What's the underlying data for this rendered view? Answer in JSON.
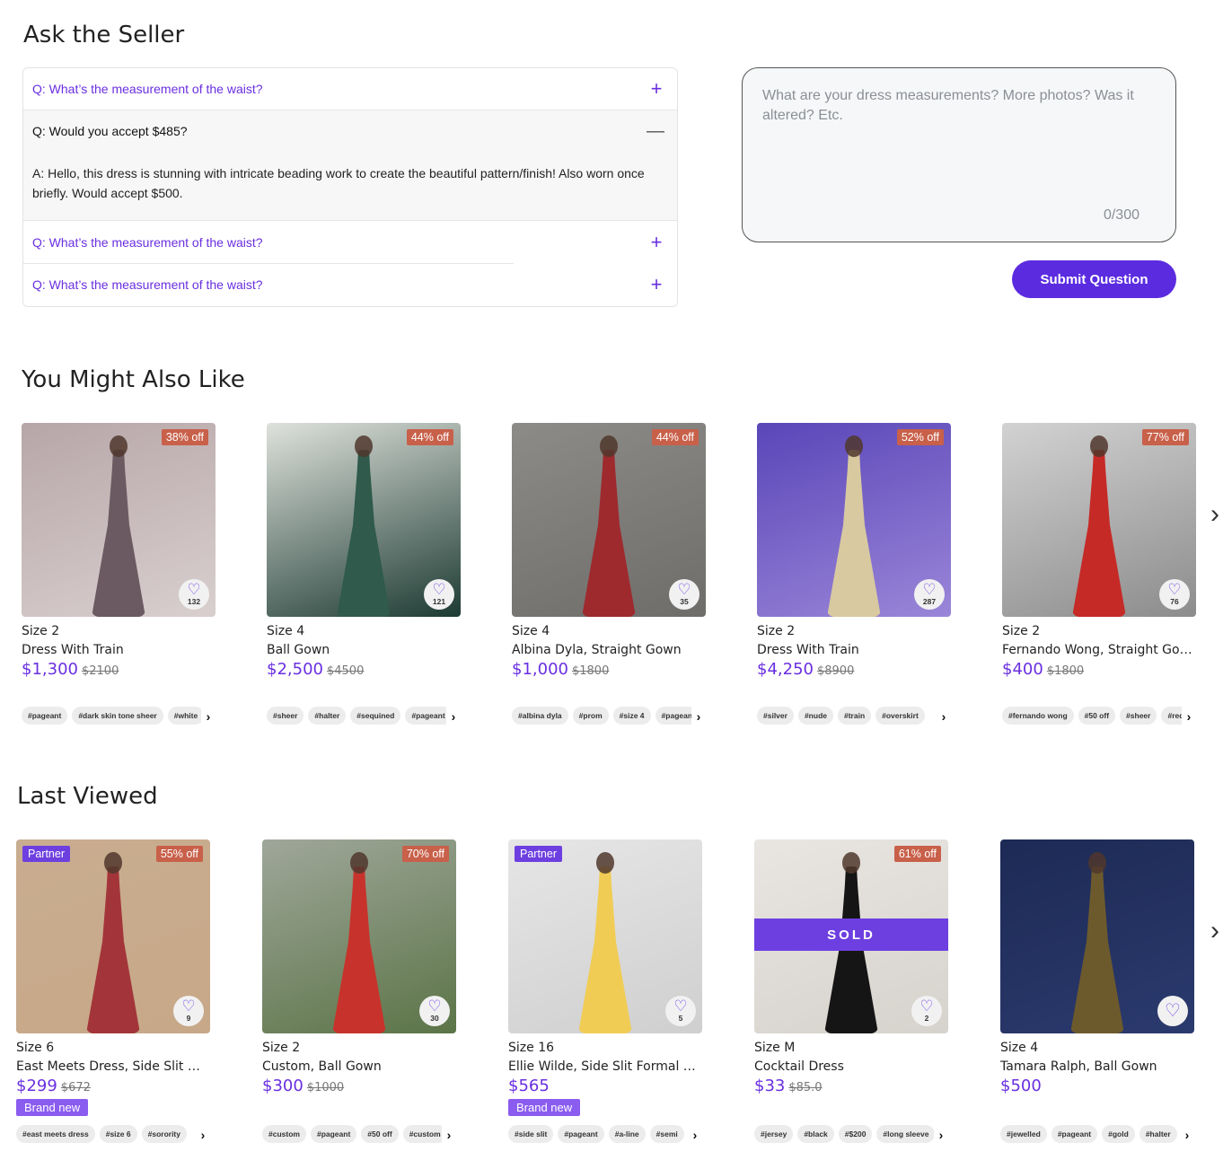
{
  "ask": {
    "title": "Ask the Seller",
    "qa": [
      {
        "q": "Q: What’s the measurement of the waist?",
        "open": false
      },
      {
        "q": "Q: Would you accept $485?",
        "open": true,
        "a": "A: Hello, this dress is stunning with intricate beading work to create the beautiful pattern/finish! Also worn once briefly. Would accept $500."
      },
      {
        "q": "Q: What’s the measurement of the waist?",
        "open": false
      },
      {
        "q": "Q: What’s the measurement of the waist?",
        "open": false
      }
    ],
    "placeholder": "What are your dress measurements? More photos? Was it altered? Etc.",
    "counter": "0/300",
    "submit_label": "Submit Question"
  },
  "icons": {
    "plus": "plus-icon",
    "minus": "minus-icon",
    "heart": "heart-icon",
    "chevron": "chevron-right-icon"
  },
  "colors": {
    "accent": "#6a2fe0",
    "button": "#5b2be0",
    "discount_badge": "#c8604a",
    "partner_badge": "#6d3fe0"
  },
  "might_like": {
    "title": "You Might Also Like",
    "cards": [
      {
        "off": "38% off",
        "likes": "132",
        "size": "Size 2",
        "name": "Dress With Train",
        "price": "$1,300",
        "old": "$2100",
        "tags": [
          "#pageant",
          "#dark skin tone sheer",
          "#white"
        ],
        "img": [
          "#b7a6a8",
          "#6b5a62",
          "#d9cfcf"
        ]
      },
      {
        "off": "44% off",
        "likes": "121",
        "size": "Size 4",
        "name": "Ball Gown",
        "price": "$2,500",
        "old": "$4500",
        "tags": [
          "#sheer",
          "#halter",
          "#sequined",
          "#pageant"
        ],
        "img": [
          "#dfe2dc",
          "#2f5a4c",
          "#1d3b33"
        ]
      },
      {
        "off": "44% off",
        "likes": "35",
        "size": "Size 4",
        "name": "Albina Dyla, Straight Gown",
        "price": "$1,000",
        "old": "$1800",
        "tags": [
          "#albina dyla",
          "#prom",
          "#size 4",
          "#pageant"
        ],
        "img": [
          "#8d8b88",
          "#9e2a2e",
          "#6f6d69"
        ]
      },
      {
        "off": "52% off",
        "likes": "287",
        "size": "Size 2",
        "name": "Dress With Train",
        "price": "$4,250",
        "old": "$8900",
        "tags": [
          "#silver",
          "#nude",
          "#train",
          "#overskirt"
        ],
        "img": [
          "#5a46b8",
          "#d8c9a0",
          "#9a86d8"
        ]
      },
      {
        "off": "77% off",
        "likes": "76",
        "size": "Size 2",
        "name": "Fernando Wong, Straight Go…",
        "price": "$400",
        "old": "$1800",
        "tags": [
          "#fernando wong",
          "#50 off",
          "#sheer",
          "#red"
        ],
        "img": [
          "#d2d2d2",
          "#c62a26",
          "#8c8c8c"
        ]
      }
    ]
  },
  "last_viewed": {
    "title": "Last Viewed",
    "cards": [
      {
        "partner": "Partner",
        "off": "55% off",
        "likes": "9",
        "size": "Size 6",
        "name": "East Meets Dress, Side Slit F…",
        "price": "$299",
        "old": "$672",
        "brand_new": "Brand new",
        "tags": [
          "#east meets dress",
          "#size 6",
          "#sorority"
        ],
        "img": [
          "#c9ad90",
          "#a3353a",
          "#c7a888"
        ]
      },
      {
        "off": "70% off",
        "likes": "30",
        "size": "Size 2",
        "name": "Custom, Ball Gown",
        "price": "$300",
        "old": "$1000",
        "tags": [
          "#custom",
          "#pageant",
          "#50 off",
          "#custom"
        ],
        "img": [
          "#9fa79a",
          "#c7332c",
          "#5b7447"
        ]
      },
      {
        "partner": "Partner",
        "likes": "5",
        "size": "Size 16",
        "name": "Ellie Wilde, Side Slit Formal …",
        "price": "$565",
        "brand_new": "Brand new",
        "tags": [
          "#side slit",
          "#pageant",
          "#a-line",
          "#semi"
        ],
        "img": [
          "#e6e6e6",
          "#f0cc55",
          "#cfcfcf"
        ]
      },
      {
        "off": "61% off",
        "likes": "2",
        "sold": "SOLD",
        "size": "Size M",
        "name": "Cocktail Dress",
        "price": "$33",
        "old": "$85.0",
        "tags": [
          "#jersey",
          "#black",
          "#$200",
          "#long sleeve"
        ],
        "img": [
          "#e9e6e2",
          "#151515",
          "#d6d2cc"
        ]
      },
      {
        "size": "Size 4",
        "name": "Tamara Ralph, Ball Gown",
        "price": "$500",
        "tags": [
          "#jewelled",
          "#pageant",
          "#gold",
          "#halter"
        ],
        "img": [
          "#1d2a55",
          "#6d5a2c",
          "#2b3a6e"
        ]
      }
    ]
  }
}
